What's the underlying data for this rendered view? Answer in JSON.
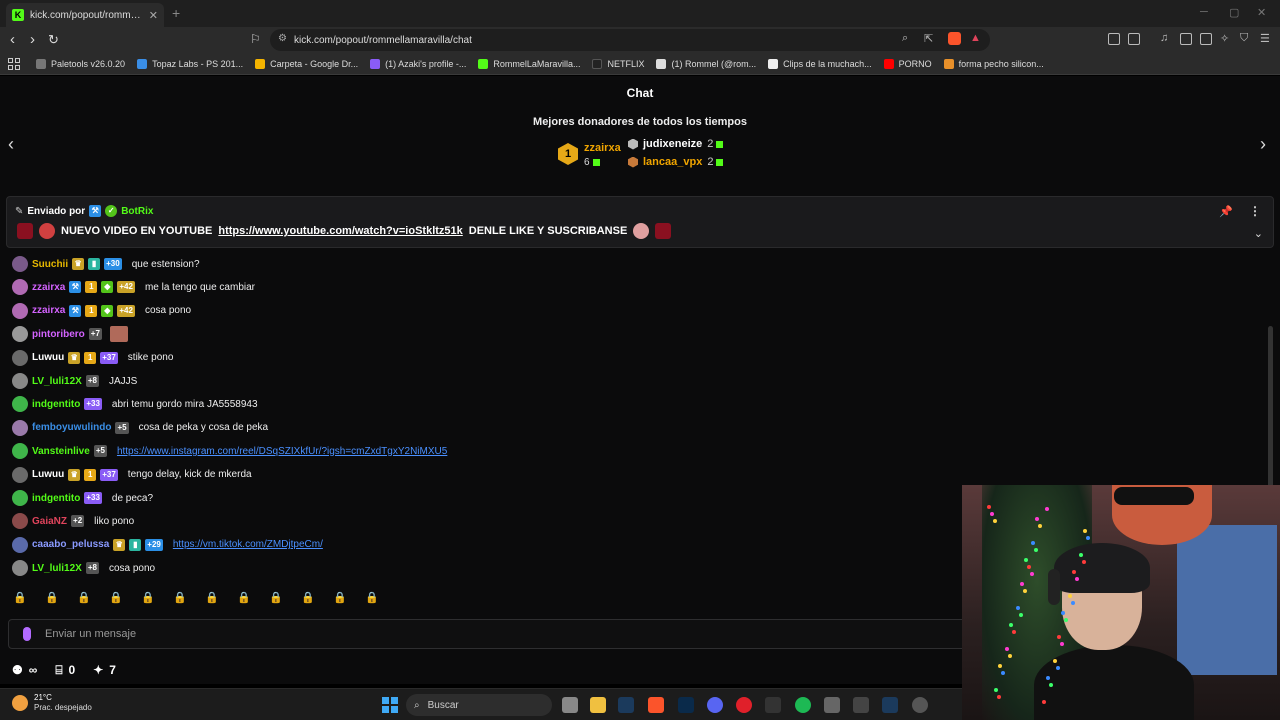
{
  "browser": {
    "tab_title": "kick.com/popout/rommellamara...",
    "url": "kick.com/popout/rommellamaravilla/chat",
    "bookmarks": [
      {
        "label": "Paletools v26.0.20",
        "color": "#777777"
      },
      {
        "label": "Topaz Labs - PS 201...",
        "color": "#3a8ee6"
      },
      {
        "label": "Carpeta - Google Dr...",
        "color": "#f4b400"
      },
      {
        "label": "(1) Azaki's profile -...",
        "color": "#8a5cf6"
      },
      {
        "label": "RommelLaMaravilla...",
        "color": "#53fc18"
      },
      {
        "label": "NETFLIX",
        "color": "#222222"
      },
      {
        "label": "(1) Rommel (@rom...",
        "color": "#dddddd"
      },
      {
        "label": "Clips de la muchach...",
        "color": "#eeeeee"
      },
      {
        "label": "PORNO",
        "color": "#ff0000"
      },
      {
        "label": "forma pecho silicon...",
        "color": "#e8902a"
      }
    ]
  },
  "chat": {
    "header": "Chat",
    "donors_title": "Mejores donadores de todos los tiempos",
    "top_donor": {
      "rank": "1",
      "name": "zzairxa",
      "amount": "6"
    },
    "other_donors": [
      {
        "name": "judixeneize",
        "amount": "2",
        "color": "#ffffff",
        "hex_color": "#bbbbbb"
      },
      {
        "name": "lancaa_vpx",
        "amount": "2",
        "color": "#f0a500",
        "hex_color": "#c87a3a"
      }
    ],
    "pinned": {
      "sent_by_label": "Enviado por",
      "sender": "BotRix",
      "message_prefix": "NUEVO VIDEO EN YOUTUBE",
      "link": "https://www.youtube.com/watch?v=ioStkltz51k",
      "message_suffix": "DENLE LIKE Y SUSCRIBANSE"
    },
    "messages": [
      {
        "user": "Suuchii",
        "color": "#e6b800",
        "badges": [
          {
            "t": "♛",
            "c": "#c9a227"
          },
          {
            "t": "▮",
            "c": "#2bb5a0"
          },
          {
            "t": "+30",
            "c": "#2b8fe6"
          }
        ],
        "text": "que estension?",
        "avatar": "#7a5a8a"
      },
      {
        "user": "zzairxa",
        "color": "#d463ff",
        "badges": [
          {
            "t": "⚒",
            "c": "#2b8fe6"
          },
          {
            "t": "1",
            "c": "#e6a817"
          },
          {
            "t": "◆",
            "c": "#53c41a"
          },
          {
            "t": "+42",
            "c": "#c9a227"
          }
        ],
        "text": "me la tengo que cambiar",
        "avatar": "#b06ab3"
      },
      {
        "user": "zzairxa",
        "color": "#d463ff",
        "badges": [
          {
            "t": "⚒",
            "c": "#2b8fe6"
          },
          {
            "t": "1",
            "c": "#e6a817"
          },
          {
            "t": "◆",
            "c": "#53c41a"
          },
          {
            "t": "+42",
            "c": "#c9a227"
          }
        ],
        "text": "cosa pono",
        "avatar": "#b06ab3"
      },
      {
        "user": "pintoribero",
        "color": "#d463ff",
        "badges": [
          {
            "t": "+7",
            "c": "#555555"
          }
        ],
        "text": "",
        "avatar": "#999999",
        "emote": true
      },
      {
        "user": "Luwuu",
        "color": "#ffffff",
        "badges": [
          {
            "t": "♛",
            "c": "#c9a227"
          },
          {
            "t": "1",
            "c": "#e6a817"
          },
          {
            "t": "+37",
            "c": "#8a5cf6"
          }
        ],
        "text": "stike pono",
        "avatar": "#6a6a6a"
      },
      {
        "user": "LV_luli12X",
        "color": "#53fc18",
        "badges": [
          {
            "t": "+8",
            "c": "#555555"
          }
        ],
        "text": "JAJJS",
        "avatar": "#888888"
      },
      {
        "user": "indgentito",
        "color": "#53fc18",
        "badges": [
          {
            "t": "+33",
            "c": "#8a5cf6"
          }
        ],
        "text": "abri temu gordo mira JA5558943",
        "avatar": "#3fb54a"
      },
      {
        "user": "femboyuwulindo",
        "color": "#3a8ee6",
        "badges": [
          {
            "t": "+5",
            "c": "#555555"
          }
        ],
        "text": "cosa de peka y cosa de peka",
        "avatar": "#9a7aaa"
      },
      {
        "user": "Vansteinlive",
        "color": "#53fc18",
        "badges": [
          {
            "t": "+5",
            "c": "#555555"
          }
        ],
        "text": "",
        "link": "https://www.instagram.com/reel/DSqSZIXkfUr/?igsh=cmZxdTgxY2NiMXU5",
        "avatar": "#3fb54a"
      },
      {
        "user": "Luwuu",
        "color": "#ffffff",
        "badges": [
          {
            "t": "♛",
            "c": "#c9a227"
          },
          {
            "t": "1",
            "c": "#e6a817"
          },
          {
            "t": "+37",
            "c": "#8a5cf6"
          }
        ],
        "text": "tengo delay, kick de mkerda",
        "avatar": "#6a6a6a"
      },
      {
        "user": "indgentito",
        "color": "#53fc18",
        "badges": [
          {
            "t": "+33",
            "c": "#8a5cf6"
          }
        ],
        "text": "de peca?",
        "avatar": "#3fb54a"
      },
      {
        "user": "GaiaNZ",
        "color": "#e0445c",
        "badges": [
          {
            "t": "+2",
            "c": "#555555"
          }
        ],
        "text": "liko pono",
        "avatar": "#8a4a4a"
      },
      {
        "user": "caaabo_pelussa",
        "color": "#8a9aff",
        "badges": [
          {
            "t": "♛",
            "c": "#c9a227"
          },
          {
            "t": "▮",
            "c": "#2bb5a0"
          },
          {
            "t": "+29",
            "c": "#2b8fe6"
          }
        ],
        "text": "",
        "link": "https://vm.tiktok.com/ZMDjtpeCm/",
        "avatar": "#5a6aaa"
      },
      {
        "user": "LV_luli12X",
        "color": "#53fc18",
        "badges": [
          {
            "t": "+8",
            "c": "#555555"
          }
        ],
        "text": "cosa pono",
        "avatar": "#888888"
      }
    ],
    "emote_slots": 12,
    "input_placeholder": "Enviar un mensaje",
    "stats": {
      "viewers": "∞",
      "gifts": "0",
      "points": "7"
    }
  },
  "taskbar": {
    "temperature": "21°C",
    "weather": "Prac. despejado",
    "search_placeholder": "Buscar"
  }
}
